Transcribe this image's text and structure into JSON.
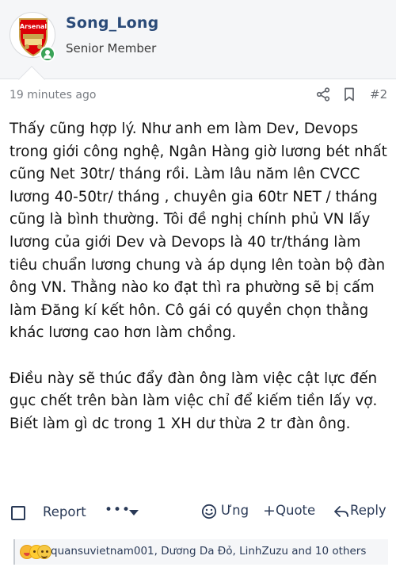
{
  "author": {
    "username": "Song_Long",
    "title": "Senior Member",
    "avatar_text": "Arsenal",
    "online": true
  },
  "post": {
    "timestamp": "19 minutes ago",
    "number": "#2",
    "paragraphs": [
      "Thấy cũng hợp lý. Như anh em làm Dev, Devops trong giới công nghệ, Ngân Hàng giờ lương bét nhất cũng Net 30tr/ tháng rồi. Làm lâu năm lên CVCC lương 40-50tr/ tháng , chuyên gia 60tr NET / tháng cũng là bình thường. Tôi đề nghị chính phủ VN lấy lương của giới Dev và Devops là 40 tr/tháng làm tiêu chuẩn lương chung và áp dụng lên toàn bộ đàn ông VN. Thằng nào ko đạt thì ra phường sẽ bị cấm làm Đăng kí kết hôn. Cô gái có quyền chọn thằng khác lương cao hơn làm chồng.",
      "Điều này sẽ thúc đẩy đàn ông làm việc cật lực đến gục chết trên bàn làm việc chỉ để kiếm tiền lấy vợ. Biết làm gì dc trong 1 XH dư thừa 2 tr đàn ông."
    ]
  },
  "actions": {
    "report_label": "Report",
    "more_label": "•••",
    "react_label": "Ưng",
    "quote_label": "Quote",
    "quote_prefix": "+",
    "reply_label": "Reply"
  },
  "reactions": {
    "users_text": "quansuvietnam001, Dương Da Đỏ, LinhZuzu and 10 others"
  },
  "colors": {
    "accent": "#2a4a78",
    "action_text": "#2a3a57",
    "online": "#3aa357",
    "header_bg": "#f5f6f8",
    "arsenal_red": "#db0007"
  }
}
